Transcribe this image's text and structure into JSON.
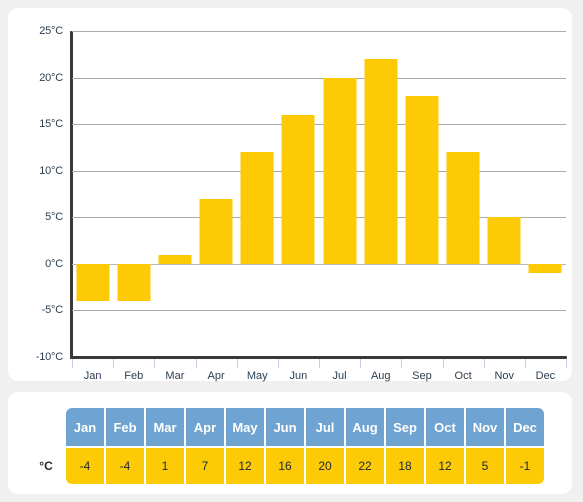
{
  "chart_data": {
    "type": "bar",
    "title": "",
    "xlabel": "",
    "ylabel": "",
    "unit": "°C",
    "categories": [
      "Jan",
      "Feb",
      "Mar",
      "Apr",
      "May",
      "Jun",
      "Jul",
      "Aug",
      "Sep",
      "Oct",
      "Nov",
      "Dec"
    ],
    "values": [
      -4,
      -4,
      1,
      7,
      12,
      16,
      20,
      22,
      18,
      12,
      5,
      -1
    ],
    "ylim": [
      -10,
      25
    ],
    "ytick_values": [
      25,
      20,
      15,
      10,
      5,
      0,
      -5,
      -10
    ],
    "ytick_labels": [
      "25°C",
      "20°C",
      "15°C",
      "10°C",
      "5°C",
      "0°C",
      "-5°C",
      "-10°C"
    ],
    "grid": true,
    "legend": "none",
    "bar_color": "#fdcb06"
  },
  "table": {
    "row_label": "°C",
    "headers": [
      "Jan",
      "Feb",
      "Mar",
      "Apr",
      "May",
      "Jun",
      "Jul",
      "Aug",
      "Sep",
      "Oct",
      "Nov",
      "Dec"
    ],
    "values": [
      "-4",
      "-4",
      "1",
      "7",
      "12",
      "16",
      "20",
      "22",
      "18",
      "12",
      "5",
      "-1"
    ],
    "header_color": "#6fa3d2",
    "cell_color": "#fdcb06"
  }
}
